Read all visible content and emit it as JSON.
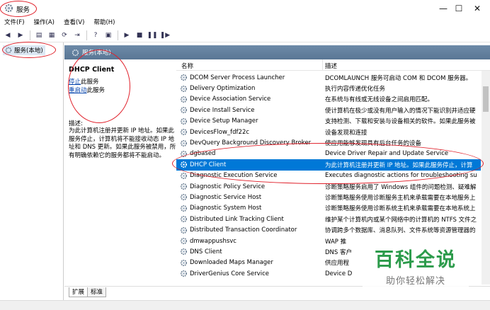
{
  "window": {
    "title": "服务",
    "min_glyph": "—",
    "max_glyph": "☐",
    "close_glyph": "✕"
  },
  "menu": [
    "文件(F)",
    "操作(A)",
    "查看(V)",
    "帮助(H)"
  ],
  "tree": {
    "item": "服务(本地)"
  },
  "header": {
    "title": "服务(本地)"
  },
  "detail": {
    "service_name": "DHCP Client",
    "stop_link": "停止",
    "stop_suffix": "此服务",
    "restart_link": "重启动",
    "restart_suffix": "此服务",
    "desc_label": "描述:",
    "desc_text": "为此计算机注册并更新 IP 地址。如果此服务停止，计算机将不能接收动态 IP 地址和 DNS 更新。如果此服务被禁用，所有明确依赖它的服务都将不能启动。"
  },
  "list": {
    "col_name": "名称",
    "col_desc": "描述",
    "sort_glyph": "^",
    "rows": [
      {
        "name": "DCOM Server Process Launcher",
        "desc": "DCOMLAUNCH 服务可启动 COM 和 DCOM 服务器。"
      },
      {
        "name": "Delivery Optimization",
        "desc": "执行内容传递优化任务"
      },
      {
        "name": "Device Association Service",
        "desc": "在系统与有线或无线设备之间启用匹配。"
      },
      {
        "name": "Device Install Service",
        "desc": "使计算机在极少或没有用户输入的情况下能识别并适应硬"
      },
      {
        "name": "Device Setup Manager",
        "desc": "支持检测、下载和安装与设备相关的软件。如果此服务被"
      },
      {
        "name": "DevicesFlow_fdf22c",
        "desc": "设备发现和连接"
      },
      {
        "name": "DevQuery Background Discovery Broker",
        "desc": "使应用能够发现具有后台任务的设备"
      },
      {
        "name": "dgbased",
        "desc": "Device Driver Repair and Update Service"
      },
      {
        "name": "DHCP Client",
        "desc": "为此计算机注册并更新 IP 地址。如果此服务停止，计算",
        "selected": true
      },
      {
        "name": "Diagnostic Execution Service",
        "desc": "Executes diagnostic actions for troubleshooting su"
      },
      {
        "name": "Diagnostic Policy Service",
        "desc": "诊断策略服务启用了 Windows 组件的问题检测、疑难解"
      },
      {
        "name": "Diagnostic Service Host",
        "desc": "诊断策略服务使用诊断服务主机来承载需要在本地服务上"
      },
      {
        "name": "Diagnostic System Host",
        "desc": "诊断策略服务使用诊断系统主机来承载需要在本地系统上"
      },
      {
        "name": "Distributed Link Tracking Client",
        "desc": "维护某个计算机内或某个网络中的计算机的 NTFS 文件之"
      },
      {
        "name": "Distributed Transaction Coordinator",
        "desc": "协调跨多个数据库、消息队列、文件系统等资源管理器的"
      },
      {
        "name": "dmwappushsvc",
        "desc": "WAP 推"
      },
      {
        "name": "DNS Client",
        "desc": "DNS 客户"
      },
      {
        "name": "Downloaded Maps Manager",
        "desc": "供应用程"
      },
      {
        "name": "DriverGenius Core Service",
        "desc": "Device D"
      }
    ]
  },
  "tabs": {
    "extended": "扩展",
    "standard": "标准"
  },
  "watermark": {
    "title": "百科全说",
    "subtitle": "助你轻松解决"
  },
  "colors": {
    "selection": "#0078d7",
    "annotation": "#e0202a",
    "watermark": "#2c9b4b"
  }
}
